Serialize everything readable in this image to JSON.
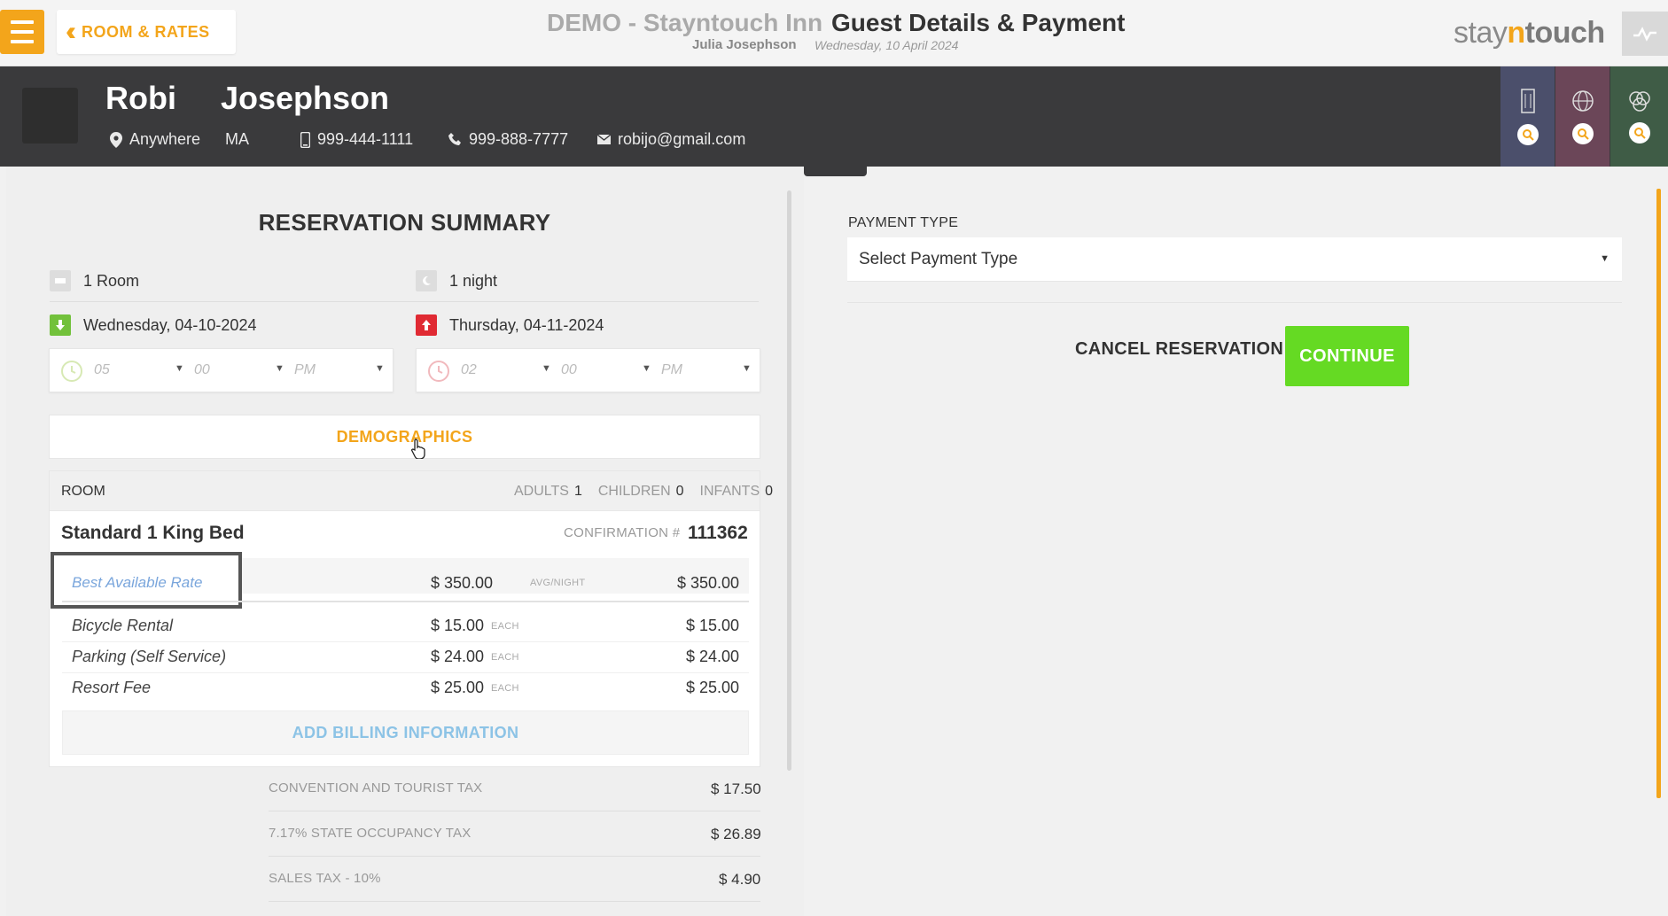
{
  "topbar": {
    "back_label": "ROOM & RATES",
    "hotel_title": "DEMO - Stayntouch Inn",
    "page_title": "Guest Details & Payment",
    "user_name": "Julia Josephson",
    "business_date": "Wednesday, 10 April 2024",
    "logo": {
      "part1": "stay",
      "part2": "n",
      "part3": "touch"
    }
  },
  "guest": {
    "first_name": "Robi",
    "last_name": "Josephson",
    "city": "Anywhere",
    "state": "MA",
    "mobile": "999-444-1111",
    "phone": "999-888-7777",
    "email": "robijo@gmail.com"
  },
  "summary": {
    "title": "RESERVATION SUMMARY",
    "rooms": "1 Room",
    "nights": "1 night",
    "arrival_date": "Wednesday, 04-10-2024",
    "departure_date": "Thursday, 04-11-2024",
    "arrival_time": {
      "hour": "05",
      "minute": "00",
      "ampm": "PM"
    },
    "departure_time": {
      "hour": "02",
      "minute": "00",
      "ampm": "PM"
    },
    "demographics_label": "DEMOGRAPHICS"
  },
  "room": {
    "section_label": "ROOM",
    "adults_label": "ADULTS",
    "adults": "1",
    "children_label": "CHILDREN",
    "children": "0",
    "infants_label": "INFANTS",
    "infants": "0",
    "room_type": "Standard 1 King Bed",
    "confirmation_label": "CONFIRMATION #",
    "confirmation_number": "111362",
    "rate": {
      "name": "Best Available Rate",
      "price": "$ 350.00",
      "unit": "AVG/NIGHT",
      "total": "$ 350.00"
    },
    "addons": [
      {
        "name": "Bicycle Rental",
        "price": "$ 15.00",
        "unit": "EACH",
        "total": "$ 15.00"
      },
      {
        "name": "Parking (Self Service)",
        "price": "$ 24.00",
        "unit": "EACH",
        "total": "$ 24.00"
      },
      {
        "name": "Resort Fee",
        "price": "$ 25.00",
        "unit": "EACH",
        "total": "$ 25.00"
      }
    ],
    "add_billing_label": "ADD BILLING INFORMATION"
  },
  "taxes": [
    {
      "label": "CONVENTION AND TOURIST TAX",
      "value": "$ 17.50"
    },
    {
      "label": "7.17% STATE OCCUPANCY TAX",
      "value": "$ 26.89"
    },
    {
      "label": "SALES TAX - 10%",
      "value": "$ 4.90"
    }
  ],
  "payment": {
    "label": "PAYMENT TYPE",
    "selected": "Select Payment Type",
    "cancel_label": "CANCEL RESERVATION",
    "continue_label": "CONTINUE"
  },
  "colors": {
    "accent": "#f3a51b",
    "continue_green": "#65da23",
    "header_dark": "#3a3a3c",
    "arrival_green": "#72c13b",
    "departure_red": "#e02a33",
    "link_blue": "#7aa6dc",
    "tab_blue": "#4b4f6b",
    "tab_purple": "#6b4658",
    "tab_green": "#3f5c46"
  },
  "icons": [
    "menu-icon",
    "chevron-double-left-icon",
    "activity-icon",
    "location-pin-icon",
    "mobile-phone-icon",
    "phone-icon",
    "envelope-icon",
    "building-icon",
    "globe-icon",
    "circles-icon",
    "search-icon",
    "room-icon",
    "moon-icon",
    "arrival-arrow-icon",
    "departure-arrow-icon",
    "clock-icon",
    "chevron-down-icon",
    "cursor-hand-icon"
  ]
}
